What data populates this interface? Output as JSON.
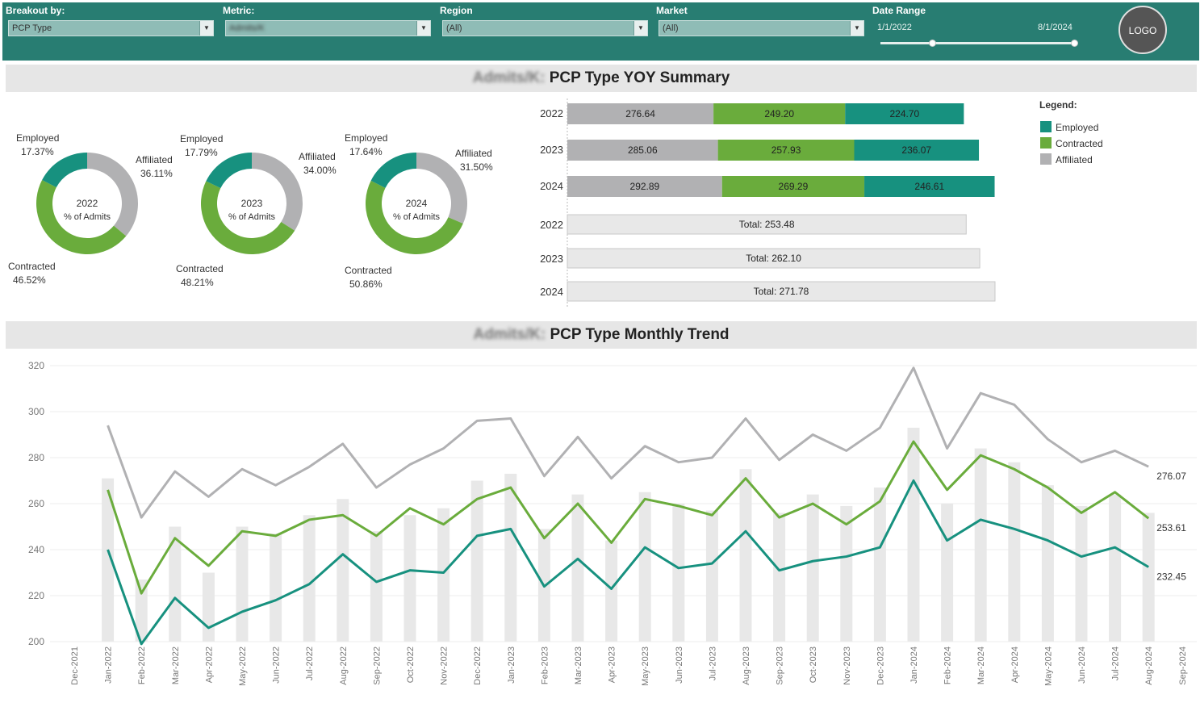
{
  "filters": {
    "breakout": {
      "label": "Breakout by:",
      "value": "PCP Type"
    },
    "metric": {
      "label": "Metric:",
      "value": "Admits/K"
    },
    "region": {
      "label": "Region",
      "value": "(All)"
    },
    "market": {
      "label": "Market",
      "value": "(All)"
    },
    "date_range": {
      "label": "Date Range",
      "start": "1/1/2022",
      "end": "8/1/2024"
    }
  },
  "logo": "LOGO",
  "summary_header": {
    "metric": "Admits/K:",
    "title": "PCP Type YOY Summary"
  },
  "trend_header": {
    "metric": "Admits/K:",
    "title": "PCP Type Monthly Trend"
  },
  "colors": {
    "employed": "#17917f",
    "contracted": "#6aac3c",
    "affiliated": "#b1b1b3",
    "total_bar": "#e8e8e8",
    "header_bar": "#287d72"
  },
  "legend": {
    "title": "Legend:",
    "items": [
      "Employed",
      "Contracted",
      "Affiliated"
    ]
  },
  "chart_data": [
    {
      "type": "pie",
      "title": "2022",
      "subtitle": "% of Admits",
      "labels": [
        "Employed",
        "Affiliated",
        "Contracted"
      ],
      "values": [
        17.37,
        36.11,
        46.52
      ],
      "value_labels": [
        "17.37%",
        "36.11%",
        "46.52%"
      ]
    },
    {
      "type": "pie",
      "title": "2023",
      "subtitle": "% of Admits",
      "labels": [
        "Employed",
        "Affiliated",
        "Contracted"
      ],
      "values": [
        17.79,
        34.0,
        48.21
      ],
      "value_labels": [
        "17.79%",
        "34.00%",
        "48.21%"
      ]
    },
    {
      "type": "pie",
      "title": "2024",
      "subtitle": "% of Admits",
      "labels": [
        "Employed",
        "Affiliated",
        "Contracted"
      ],
      "values": [
        17.64,
        31.5,
        50.86
      ],
      "value_labels": [
        "17.64%",
        "31.50%",
        "50.86%"
      ]
    },
    {
      "type": "bar",
      "orientation": "horizontal-stacked",
      "categories": [
        "2022",
        "2023",
        "2024"
      ],
      "series": [
        {
          "name": "Affiliated",
          "values": [
            276.64,
            285.06,
            292.89
          ]
        },
        {
          "name": "Contracted",
          "values": [
            249.2,
            257.93,
            269.29
          ]
        },
        {
          "name": "Employed",
          "values": [
            224.7,
            236.07,
            246.61
          ]
        }
      ]
    },
    {
      "type": "bar",
      "orientation": "horizontal",
      "categories": [
        "2022",
        "2023",
        "2024"
      ],
      "values": [
        253.48,
        262.1,
        271.78
      ],
      "value_labels": [
        "Total: 253.48",
        "Total: 262.10",
        "Total: 271.78"
      ]
    },
    {
      "type": "line",
      "x": [
        "Dec-2021",
        "Jan-2022",
        "Feb-2022",
        "Mar-2022",
        "Apr-2022",
        "May-2022",
        "Jun-2022",
        "Jul-2022",
        "Aug-2022",
        "Sep-2022",
        "Oct-2022",
        "Nov-2022",
        "Dec-2022",
        "Jan-2023",
        "Feb-2023",
        "Mar-2023",
        "Apr-2023",
        "May-2023",
        "Jun-2023",
        "Jul-2023",
        "Aug-2023",
        "Sep-2023",
        "Oct-2023",
        "Nov-2023",
        "Dec-2023",
        "Jan-2024",
        "Feb-2024",
        "Mar-2024",
        "Apr-2024",
        "May-2024",
        "Jun-2024",
        "Jul-2024",
        "Aug-2024",
        "Sep-2024"
      ],
      "yticks": [
        200,
        220,
        240,
        260,
        280,
        300,
        320
      ],
      "ylim": [
        193,
        322
      ],
      "bars": {
        "name": "Total",
        "values": [
          null,
          271,
          227,
          250,
          230,
          250,
          247,
          255,
          262,
          248,
          255,
          258,
          270,
          273,
          249,
          264,
          244,
          265,
          260,
          257,
          275,
          256,
          264,
          259,
          267,
          293,
          260,
          284,
          278,
          268,
          259,
          264,
          256,
          null
        ]
      },
      "series": [
        {
          "name": "Affiliated",
          "values": [
            null,
            294,
            254,
            274,
            263,
            275,
            268,
            276,
            286,
            267,
            277,
            284,
            296,
            297,
            272,
            289,
            271,
            285,
            278,
            280,
            297,
            279,
            290,
            283,
            293,
            319,
            284,
            308,
            303,
            288,
            278,
            283,
            276.07,
            null
          ],
          "end_label": "276.07"
        },
        {
          "name": "Contracted",
          "values": [
            null,
            266,
            221,
            245,
            233,
            248,
            246,
            253,
            255,
            246,
            258,
            251,
            262,
            267,
            245,
            260,
            243,
            262,
            259,
            255,
            271,
            254,
            260,
            251,
            261,
            287,
            266,
            281,
            275,
            267,
            256,
            265,
            253.61,
            null
          ],
          "end_label": "253.61"
        },
        {
          "name": "Employed",
          "values": [
            null,
            240,
            199,
            219,
            206,
            213,
            218,
            225,
            238,
            226,
            231,
            230,
            246,
            249,
            224,
            236,
            223,
            241,
            232,
            234,
            248,
            231,
            235,
            237,
            241,
            270,
            244,
            253,
            249,
            244,
            237,
            241,
            232.45,
            null
          ],
          "end_label": "232.45"
        }
      ]
    }
  ]
}
